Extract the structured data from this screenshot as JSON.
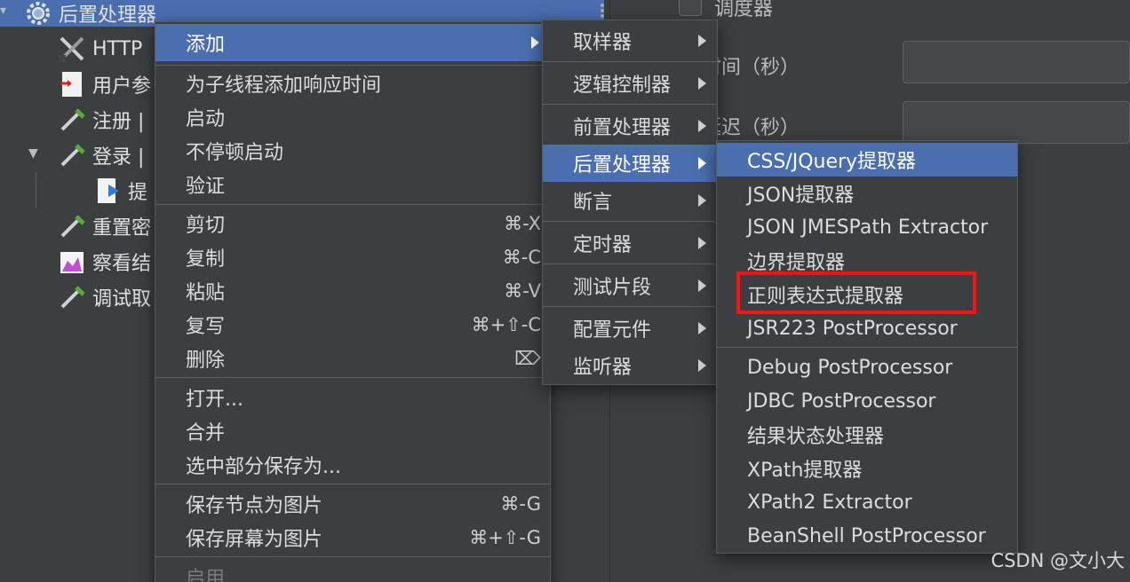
{
  "tree": {
    "rows": [
      {
        "label": "后置处理器",
        "icon": "gear-icon"
      },
      {
        "label": "HTTP",
        "icon": "wrench-screwdriver-icon"
      },
      {
        "label": "用户参",
        "icon": "user-params-doc-icon"
      },
      {
        "label": "注册 |",
        "icon": "pipette-icon"
      },
      {
        "label": "登录 |",
        "icon": "pipette-icon"
      },
      {
        "label": "提",
        "icon": "extractor-doc-icon"
      },
      {
        "label": "重置密",
        "icon": "pipette-icon"
      },
      {
        "label": "察看结",
        "icon": "results-graph-icon"
      },
      {
        "label": "调试取",
        "icon": "pipette-icon"
      }
    ]
  },
  "panel": {
    "scheduler_label": "调度器",
    "duration_label": "时间（秒）",
    "delay_label": "延迟（秒）"
  },
  "context_menu": {
    "items": [
      {
        "label": "添加",
        "submenu": true
      },
      {
        "label": "为子线程添加响应时间"
      },
      {
        "label": "启动"
      },
      {
        "label": "不停顿启动"
      },
      {
        "label": "验证"
      },
      {
        "label": "剪切",
        "shortcut": "⌘-X"
      },
      {
        "label": "复制",
        "shortcut": "⌘-C"
      },
      {
        "label": "粘贴",
        "shortcut": "⌘-V"
      },
      {
        "label": "复写",
        "shortcut": "⌘+⇧-C"
      },
      {
        "label": "删除",
        "shortcut": "⌦"
      },
      {
        "label": "打开..."
      },
      {
        "label": "合并"
      },
      {
        "label": "选中部分保存为..."
      },
      {
        "label": "保存节点为图片",
        "shortcut": "⌘-G"
      },
      {
        "label": "保存屏幕为图片",
        "shortcut": "⌘+⇧-G"
      },
      {
        "label": "启用"
      }
    ]
  },
  "add_submenu": {
    "items": [
      {
        "label": "取样器"
      },
      {
        "label": "逻辑控制器"
      },
      {
        "label": "前置处理器"
      },
      {
        "label": "后置处理器"
      },
      {
        "label": "断言"
      },
      {
        "label": "定时器"
      },
      {
        "label": "测试片段"
      },
      {
        "label": "配置元件"
      },
      {
        "label": "监听器"
      }
    ]
  },
  "postprocessor_submenu": {
    "items": [
      {
        "label": "CSS/JQuery提取器"
      },
      {
        "label": "JSON提取器"
      },
      {
        "label": "JSON JMESPath Extractor"
      },
      {
        "label": "边界提取器"
      },
      {
        "label": "正则表达式提取器"
      },
      {
        "label": "JSR223 PostProcessor"
      },
      {
        "label": "Debug PostProcessor"
      },
      {
        "label": "JDBC PostProcessor"
      },
      {
        "label": "结果状态处理器"
      },
      {
        "label": "XPath提取器"
      },
      {
        "label": "XPath2 Extractor"
      },
      {
        "label": "BeanShell PostProcessor"
      }
    ]
  },
  "watermark": "CSDN @文小大",
  "colors": {
    "highlight": "#4b6eaf",
    "annotation_box": "#ff1010",
    "background": "#3c3f41"
  }
}
